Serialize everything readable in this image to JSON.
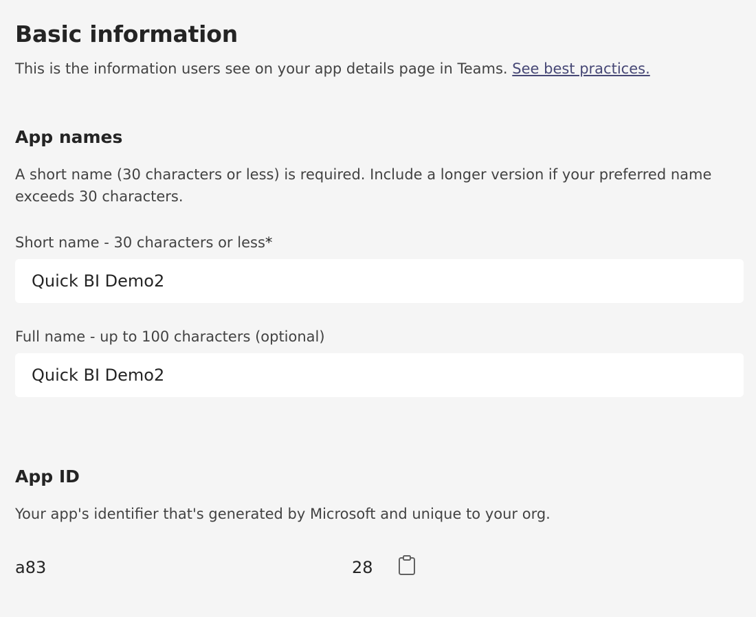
{
  "header": {
    "title": "Basic information",
    "description": "This is the information users see on your app details page in Teams.",
    "link_label": "See best practices."
  },
  "app_names": {
    "title": "App names",
    "description": "A short name (30 characters or less) is required. Include a longer version if your preferred name exceeds 30 characters.",
    "short_name": {
      "label": "Short name - 30 characters or less",
      "required_marker": "*",
      "value": "Quick BI Demo2"
    },
    "full_name": {
      "label": "Full name - up to 100 characters (optional)",
      "value": "Quick BI Demo2"
    }
  },
  "app_id": {
    "title": "App ID",
    "description": "Your app's identifier that's generated by Microsoft and unique to your org.",
    "value_start": "a83",
    "value_end": "28",
    "copy_icon": "copy-icon"
  }
}
